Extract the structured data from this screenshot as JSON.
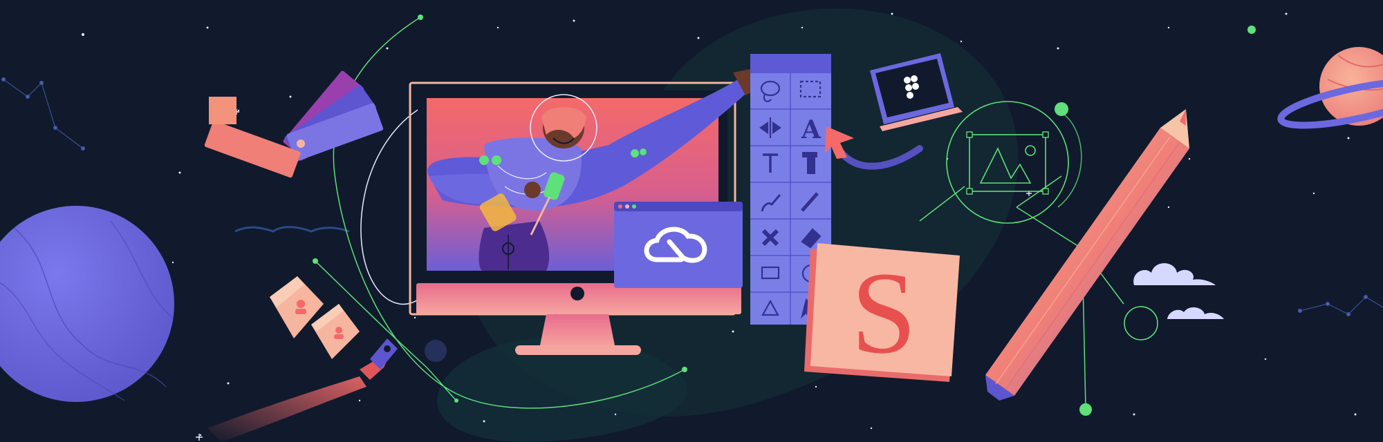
{
  "toolbar": {
    "items": [
      {
        "icon": "lasso-icon"
      },
      {
        "icon": "marquee-select-icon"
      },
      {
        "icon": "flip-icon"
      },
      {
        "icon": "type-tool-icon",
        "glyph": "A"
      },
      {
        "icon": "text-tool-icon",
        "glyph": "T"
      },
      {
        "icon": "crop-icon"
      },
      {
        "icon": "brush-icon"
      },
      {
        "icon": "pencil-tool-icon"
      },
      {
        "icon": "healing-icon"
      },
      {
        "icon": "eraser-icon"
      },
      {
        "icon": "rectangle-icon"
      },
      {
        "icon": "ellipse-icon"
      },
      {
        "icon": "triangle-icon"
      },
      {
        "icon": "cursor-icon"
      }
    ]
  },
  "logo_card": {
    "icon": "creative-cloud-icon"
  },
  "laptop": {
    "icon": "figma-icon"
  },
  "sticky_note": {
    "letter": "S"
  },
  "image_node": {
    "icon": "image-placeholder-icon"
  },
  "colors": {
    "background": "#101a2c",
    "accent_purple": "#6c68e0",
    "accent_coral": "#f46a6a",
    "accent_peach": "#f6b59f",
    "vector_green": "#5ee07a"
  }
}
